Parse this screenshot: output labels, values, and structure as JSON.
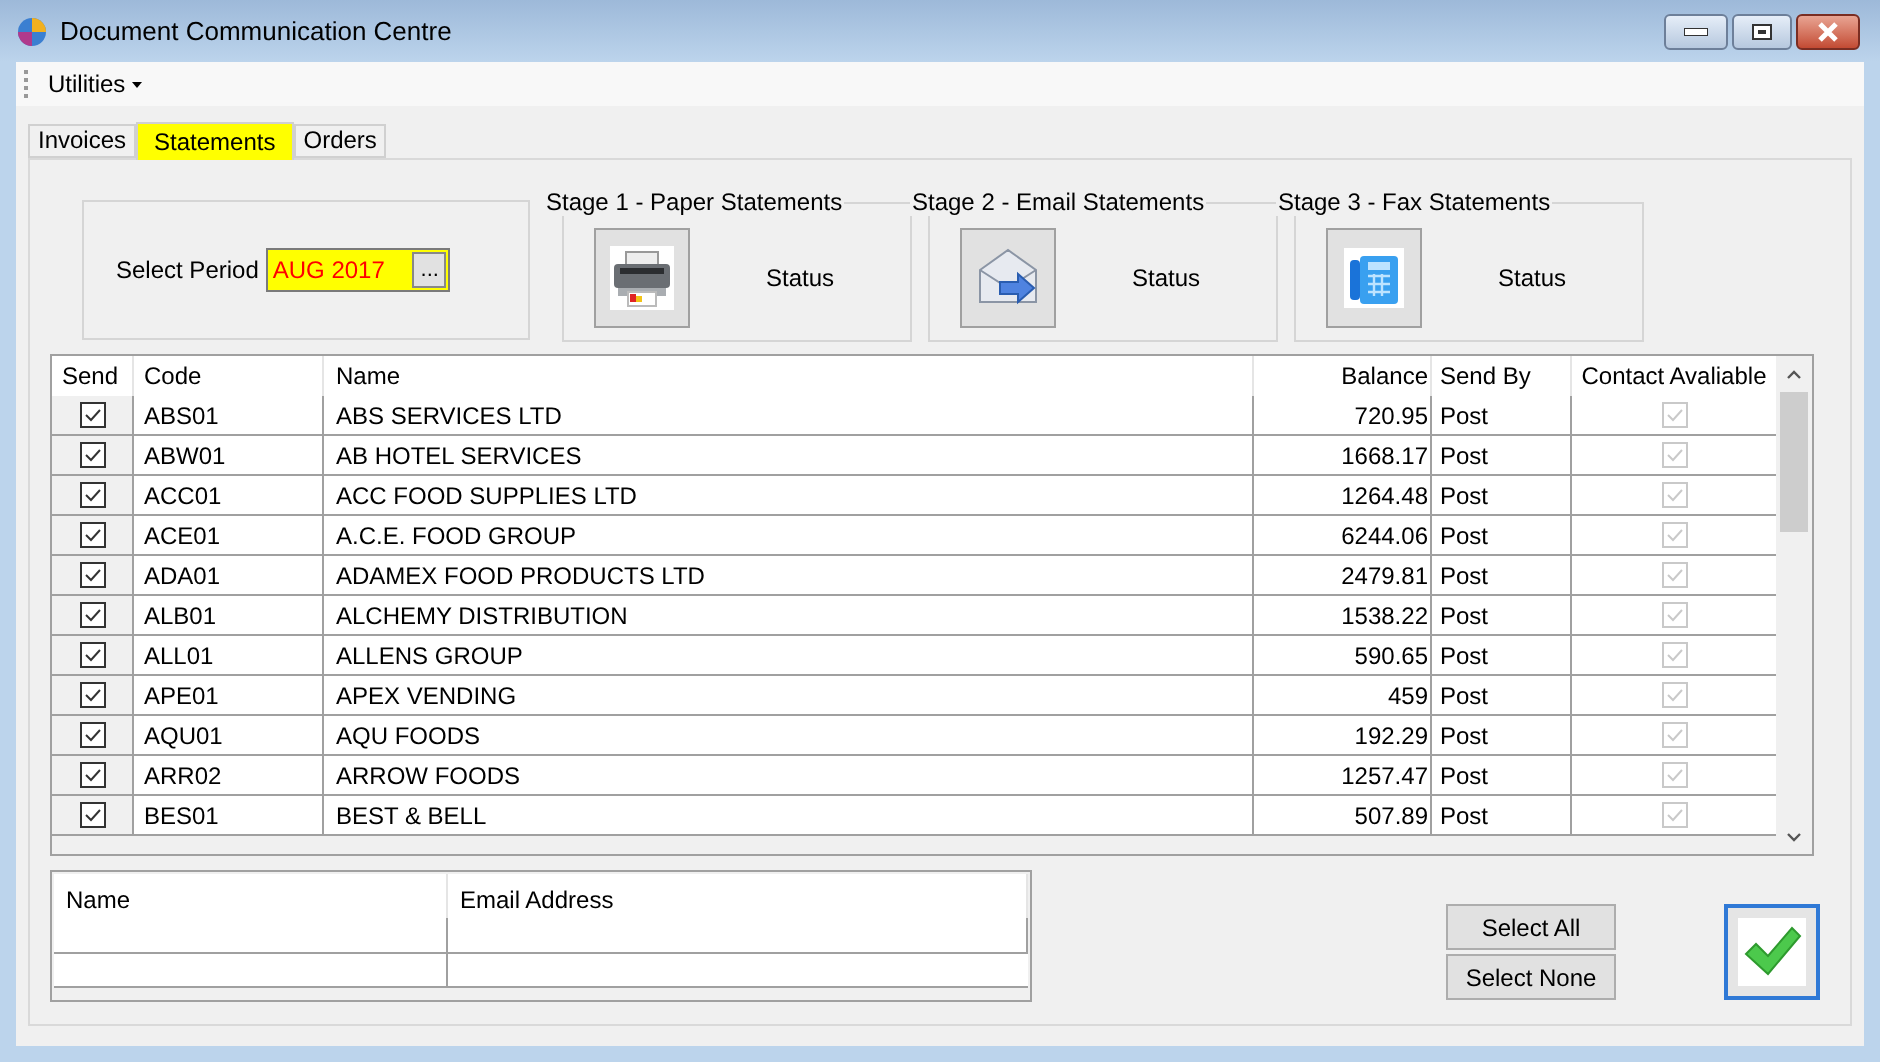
{
  "window": {
    "title": "Document Communication Centre"
  },
  "menu": [
    {
      "label": "Utilities"
    }
  ],
  "tabs": [
    {
      "label": "Invoices",
      "selected": false,
      "highlighted": false
    },
    {
      "label": "Statements",
      "selected": true,
      "highlighted": true
    },
    {
      "label": "Orders",
      "selected": false,
      "highlighted": false
    }
  ],
  "period": {
    "label": "Select Period",
    "value": "AUG 2017",
    "browse": "..."
  },
  "stages": [
    {
      "title": "Stage 1 - Paper Statements",
      "kind": "printer",
      "status": "Status"
    },
    {
      "title": "Stage 2 - Email Statements",
      "kind": "email",
      "status": "Status"
    },
    {
      "title": "Stage 3 - Fax Statements",
      "kind": "fax",
      "status": "Status"
    }
  ],
  "table": {
    "columns": [
      "Send",
      "Code",
      "Name",
      "Balance",
      "Send By",
      "Contact Avaliable"
    ],
    "rows": [
      {
        "send": true,
        "code": "ABS01",
        "name": "ABS SERVICES LTD",
        "balance": "720.95",
        "send_by": "Post",
        "contact_available": true
      },
      {
        "send": true,
        "code": "ABW01",
        "name": "AB HOTEL SERVICES",
        "balance": "1668.17",
        "send_by": "Post",
        "contact_available": true
      },
      {
        "send": true,
        "code": "ACC01",
        "name": "ACC FOOD SUPPLIES LTD",
        "balance": "1264.48",
        "send_by": "Post",
        "contact_available": true
      },
      {
        "send": true,
        "code": "ACE01",
        "name": "A.C.E. FOOD GROUP",
        "balance": "6244.06",
        "send_by": "Post",
        "contact_available": true
      },
      {
        "send": true,
        "code": "ADA01",
        "name": "ADAMEX FOOD PRODUCTS LTD",
        "balance": "2479.81",
        "send_by": "Post",
        "contact_available": true
      },
      {
        "send": true,
        "code": "ALB01",
        "name": "ALCHEMY DISTRIBUTION",
        "balance": "1538.22",
        "send_by": "Post",
        "contact_available": true
      },
      {
        "send": true,
        "code": "ALL01",
        "name": "ALLENS GROUP",
        "balance": "590.65",
        "send_by": "Post",
        "contact_available": true
      },
      {
        "send": true,
        "code": "APE01",
        "name": "APEX VENDING",
        "balance": "459",
        "send_by": "Post",
        "contact_available": true
      },
      {
        "send": true,
        "code": "AQU01",
        "name": "AQU FOODS",
        "balance": "192.29",
        "send_by": "Post",
        "contact_available": true
      },
      {
        "send": true,
        "code": "ARR02",
        "name": "ARROW FOODS",
        "balance": "1257.47",
        "send_by": "Post",
        "contact_available": true
      },
      {
        "send": true,
        "code": "BES01",
        "name": "BEST & BELL",
        "balance": "507.89",
        "send_by": "Post",
        "contact_available": true
      }
    ]
  },
  "contacts": {
    "columns": [
      "Name",
      "Email Address"
    ]
  },
  "buttons": [
    {
      "label": "Select All"
    },
    {
      "label": "Select None"
    }
  ]
}
